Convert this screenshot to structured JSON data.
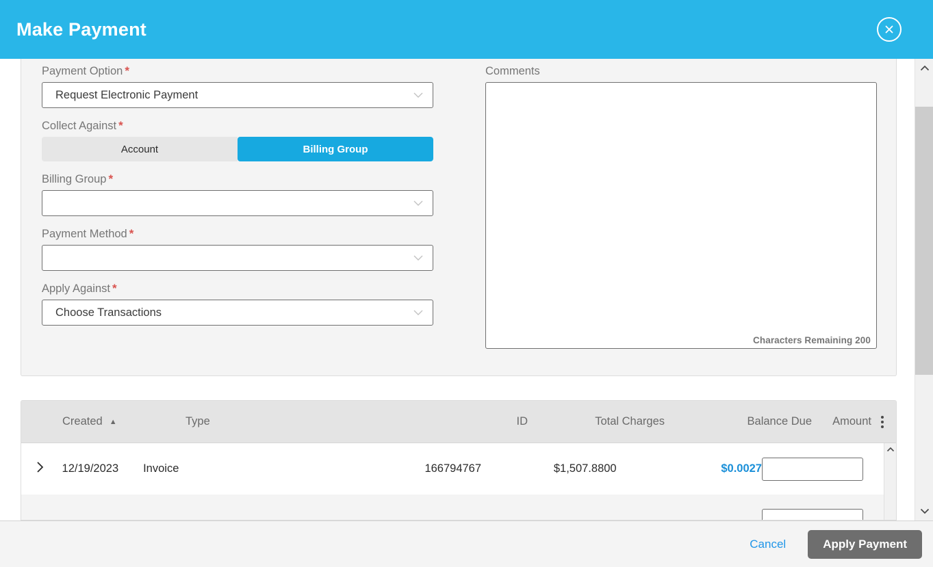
{
  "header": {
    "title": "Make Payment",
    "close_icon": "close-circle-icon",
    "background_color": "#29b6e8"
  },
  "form": {
    "payment_option": {
      "label": "Payment Option",
      "required_marker": "*",
      "value": "Request Electronic Payment",
      "caret_icon": "chevron-down-icon"
    },
    "collect_against": {
      "label": "Collect Against",
      "required_marker": "*",
      "options": [
        "Account",
        "Billing Group"
      ],
      "selected": "Billing Group",
      "selected_color": "#17a9e0"
    },
    "billing_group": {
      "label": "Billing Group",
      "required_marker": "*",
      "value": "",
      "caret_icon": "chevron-down-icon"
    },
    "payment_method": {
      "label": "Payment Method",
      "required_marker": "*",
      "value": "",
      "caret_icon": "chevron-down-icon"
    },
    "apply_against": {
      "label": "Apply Against",
      "required_marker": "*",
      "value": "Choose Transactions",
      "caret_icon": "chevron-down-icon"
    },
    "comments": {
      "label": "Comments",
      "value": "",
      "placeholder": "",
      "characters_remaining": "Characters Remaining 200"
    }
  },
  "table": {
    "columns": [
      {
        "key": "created",
        "label": "Created",
        "sort": "asc",
        "sort_icon": "sort-ascending-icon"
      },
      {
        "key": "type",
        "label": "Type"
      },
      {
        "key": "id",
        "label": "ID"
      },
      {
        "key": "total_charges",
        "label": "Total Charges"
      },
      {
        "key": "balance_due",
        "label": "Balance Due"
      },
      {
        "key": "amount",
        "label": "Amount"
      }
    ],
    "column_menu_icon": "kebab-menu-icon",
    "expand_icon": "chevron-right-icon",
    "rows": [
      {
        "created": "12/19/2023",
        "type": "Invoice",
        "id": "166794767",
        "total_charges": "$1,507.8800",
        "balance_due": "$0.0027",
        "balance_due_color": "#1a8fd8",
        "amount": ""
      },
      {
        "created": "",
        "type": "",
        "id": "",
        "total_charges": "",
        "balance_due": "",
        "amount": ""
      }
    ],
    "inner_scroll_up_icon": "chevron-up-icon"
  },
  "scrollbar": {
    "up_icon": "chevron-up-icon",
    "down_icon": "chevron-down-icon"
  },
  "footer": {
    "cancel_label": "Cancel",
    "apply_label": "Apply Payment",
    "apply_color": "#6e6e6e",
    "cancel_color": "#2196e8"
  }
}
